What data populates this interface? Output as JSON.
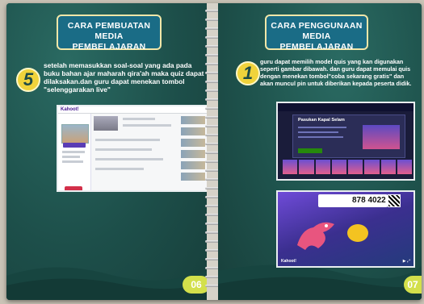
{
  "left_page": {
    "title_line1": "CARA PEMBUATAN",
    "title_line2": "MEDIA PEMBELAJARAN",
    "step_number": "5",
    "step_text": "setelah memasukkan soal-soal yang ada pada buku bahan ajar maharah qira'ah maka quiz dapat dilaksakan.dan guru dapat menekan tombol \"selenggarakan live\"",
    "screenshot_brand": "Kahoot!",
    "page_number": "06"
  },
  "right_page": {
    "title_line1": "CARA PENGGUNAAN",
    "title_line2": "MEDIA PEMBELAJARAN",
    "step_number": "1",
    "step_text": "guru dapat memilih model quis yang kan digunakan seperti gambar dibawah. dan guru dapat memulai quis dengan menekan tombol\"coba sekarang gratis\" dan akan muncul pin untuk diberikan kepada peserta didik.",
    "screenshot1_title": "Pasukan Kapal Selam",
    "screenshot2_pin": "878 4022",
    "screenshot2_brand": "Kahoot!",
    "page_number": "07"
  },
  "colors": {
    "page_bg": "#1f4f4a",
    "title_bg": "#1a6c86",
    "accent_yellow": "#f0d33b",
    "page_number_bg": "#d3e04b"
  }
}
